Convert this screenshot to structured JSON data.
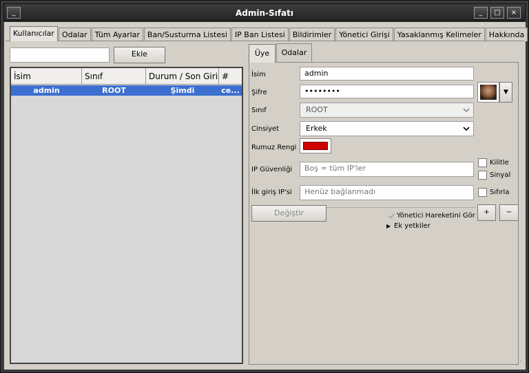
{
  "window": {
    "title": "Admin-Sıfatı"
  },
  "tabs": [
    "Kullanıcılar",
    "Odalar",
    "Tüm Ayarlar",
    "Ban/Susturma Listesi",
    "IP Ban Listesi",
    "Bildirimler",
    "Yönetici Girişi",
    "Yasaklanmış Kelimeler",
    "Hakkında"
  ],
  "left": {
    "add_input_value": "",
    "add_button": "Ekle",
    "columns": [
      "İsim",
      "Sınıf",
      "Durum / Son Giriş",
      "#"
    ],
    "rows": [
      {
        "name": "admin",
        "class": "ROOT",
        "status": "Şimdi",
        "num": "ce..."
      }
    ]
  },
  "right": {
    "subtabs": [
      "Üye",
      "Odalar"
    ],
    "fields": {
      "name_label": "İsim",
      "name_value": "admin",
      "password_label": "Şifre",
      "password_value": "••••••••",
      "class_label": "Sınıf",
      "class_value": "ROOT",
      "gender_label": "Cinsiyet",
      "gender_value": "Erkek",
      "color_label": "Rumuz Rengi",
      "color_hex": "#cc0000",
      "ip_security_label": "IP Güvenliği",
      "ip_security_placeholder": "Boş = tüm IP'ler",
      "first_ip_label": "İlk giriş IP'si",
      "first_ip_placeholder": "Henüz bağlanmadı"
    },
    "checkboxes": {
      "lock": "Kilitle",
      "signal": "Sinyal",
      "reset": "Sıfırla",
      "admin_actions": "Yönetici Hareketini Gör"
    },
    "change_button": "Değiştir",
    "plus": "+",
    "minus": "−",
    "extra_perms": "Ek yetkiler"
  }
}
